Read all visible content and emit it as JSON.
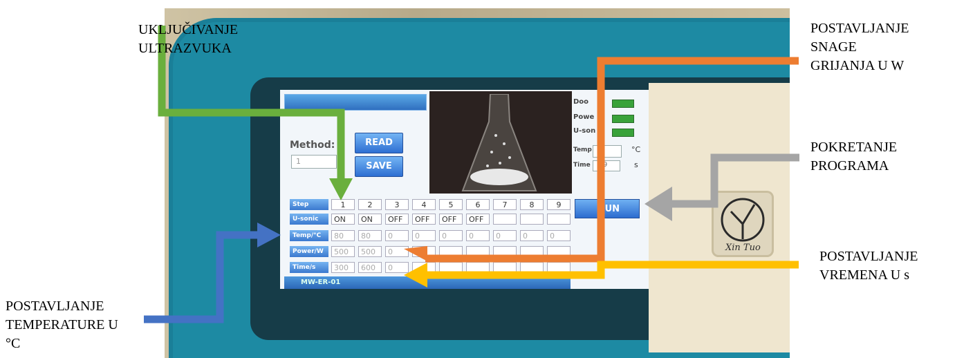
{
  "annotations": {
    "ultrasound_on": "UKLJUČIVANJE\nULTRAZVUKA",
    "heating_power": "POSTAVLJANJE\nSNAGE\nGRIJANJA U W",
    "start_program": "POKRETANJE\nPROGRAMA",
    "time_setting": "POSTAVLJANJE\nVREMENA U s",
    "temperature_setting": "POSTAVLJANJE\nTEMPERATURE U\n°C"
  },
  "arrow_colors": {
    "ultrasound": "#6aaf3d",
    "temperature": "#4472c4",
    "power": "#ed7d31",
    "time": "#ffc000",
    "start": "#a5a5a5"
  },
  "screen": {
    "method_label": "Method:",
    "method_value": "1",
    "read_button": "READ",
    "save_button": "SAVE",
    "status": [
      {
        "label": "Doo",
        "color": "#39a23a"
      },
      {
        "label": "Powe",
        "color": "#39a23a"
      },
      {
        "label": "U-son",
        "color": "#39a23a"
      }
    ],
    "temp_label": "Temp",
    "temp_unit": "°C",
    "time_label": "Time",
    "time_value": "9",
    "time_unit": "s",
    "run_button": "UN",
    "footer": "MW-ER-01",
    "table": {
      "step_header": "Step",
      "steps": [
        "1",
        "2",
        "3",
        "4",
        "5",
        "6",
        "7",
        "8",
        "9"
      ],
      "usonic_header": "U-sonic",
      "usonic": [
        "ON",
        "ON",
        "OFF",
        "OFF",
        "OFF",
        "OFF",
        "",
        "",
        ""
      ],
      "temp_header": "Temp/°C",
      "temp": [
        "80",
        "80",
        "0",
        "0",
        "0",
        "0",
        "0",
        "0",
        "0"
      ],
      "power_header": "Power/W",
      "power": [
        "500",
        "500",
        "0",
        "",
        "",
        "",
        "",
        "",
        ""
      ],
      "time_header": "Time/s",
      "time": [
        "300",
        "600",
        "0",
        "",
        "",
        "",
        "",
        "",
        ""
      ]
    }
  },
  "logo_text": "Xin Tuo"
}
